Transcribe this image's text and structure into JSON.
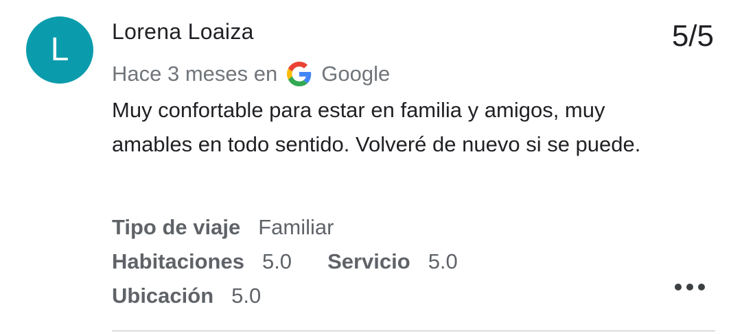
{
  "review": {
    "avatar_initial": "L",
    "avatar_color": "#0a9cac",
    "author": "Lorena Loaiza",
    "score": "5/5",
    "time_prefix": "Hace 3 meses en",
    "source_icon": "google-g-icon",
    "source_name": "Google",
    "text": "Muy confortable para estar en familia y amigos, muy amables en todo sentido. Volveré de nuevo si se puede.",
    "trip_type_label": "Tipo de viaje",
    "trip_type_value": "Familiar",
    "ratings": [
      {
        "label": "Habitaciones",
        "value": "5.0"
      },
      {
        "label": "Servicio",
        "value": "5.0"
      },
      {
        "label": "Ubicación",
        "value": "5.0"
      }
    ],
    "more_icon": "more-horizontal-icon"
  }
}
